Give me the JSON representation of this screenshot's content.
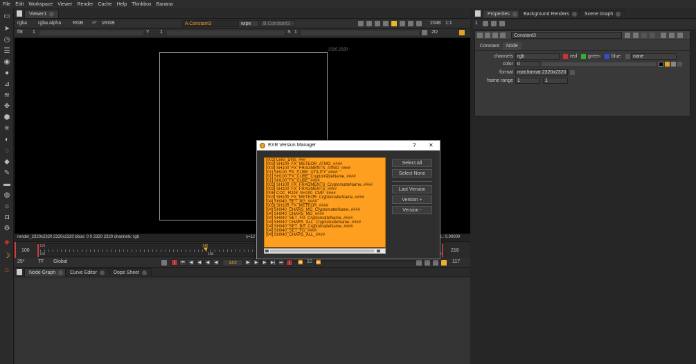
{
  "menu": [
    "File",
    "Edit",
    "Workspace",
    "Viewer",
    "Render",
    "Cache",
    "Help",
    "Thinkbox",
    "Banana"
  ],
  "viewer": {
    "tab_label": "Viewer1",
    "channels": "rgba",
    "alpha": "rgba.alpha",
    "colorspace": "RGB",
    "ip": "IP",
    "lut": "sRGB",
    "input_a": "A  Constant3",
    "wipe": "wipe",
    "input_b": "B  Constant3",
    "proxy_res": "2048",
    "zoom": "1:1",
    "fstop": "f/8",
    "frame_step": "1",
    "y_label": "Y",
    "y_value": "1",
    "s_label": "S",
    "s_value": "1",
    "view_mode": "2D",
    "format_label": "2320,2320",
    "status": "render_2320x2320 2320x2320  bbox: 0 0 2320 2320 channels: rgb",
    "status_coord": "x=12",
    "status_right": "L: 0.00000"
  },
  "timeline": {
    "in_frame": "100",
    "marker_start": "100",
    "current_frame": "142",
    "tick_150": "150",
    "out_marker": "216",
    "out_frame": "216",
    "sub_start": "100",
    "sub_end": "216",
    "fps": "25*",
    "tf": "TF",
    "range_mode": "Global",
    "play_frame": "142",
    "increment": "10",
    "end_frame": "117"
  },
  "bottom_tabs": [
    "Node Graph",
    "Curve Editor",
    "Dope Sheet"
  ],
  "properties": {
    "tabs": [
      "Properties",
      "Background Renders",
      "Scene Graph"
    ],
    "count": "1",
    "node_name": "Constant3",
    "subtabs": [
      "Constant",
      "Node"
    ],
    "channels_label": "channels",
    "channels_value": "rgb",
    "ch_red": "red",
    "ch_green": "green",
    "ch_blue": "blue",
    "ch_none": "none",
    "color_label": "color",
    "color_value": "0",
    "format_label": "format",
    "format_value": "root.format 2320x2320",
    "frame_range_label": "frame range",
    "frame_range_start": "1",
    "frame_range_end": "1"
  },
  "dialog": {
    "title": "EXR Version Manager",
    "help": "?",
    "close": "✕",
    "items": [
      "[001]   Lens_Dirts_###",
      "[003]   SH100_FX_METEOR_ATMO_####",
      "[003]   SH100_FX_FRAGMENTS_ATMO_####",
      "[01]    SH100_FX_CUBE_UTILITY_####",
      "[01]    SH100_FX_CUBE_CryptomatteName..####",
      "[01]    SH100_FX_CUBE_####",
      "[003]   SH100_FX_FRAGMENTS_CryptomatteName..####",
      "[003]   SH100_FX_FRAGMENTS_####",
      "[006]   COC_HJ25_SH100_CMP_####",
      "[003]   SH100_FX_METEOR_CryptomatteName..####",
      "[04]    SH040_SET_BG_####",
      "[003]   SH100_FX_METEOR_####",
      "[04]    SH040_CHARS_MG_CryptomatteName..####",
      "[04]    SH040_CHARS_MG_####",
      "[04]    SH040_SET_FG_CryptomatteName..####",
      "[04]    SH040_CHARS_ALL_CryptomatteName..####",
      "[04]    SH040_SET_BG_CryptomatteName..####",
      "[04]    SH040_SET_FG_####",
      "[04]    SH040_CHARS_ALL_####"
    ],
    "btn_select_all": "Select All",
    "btn_select_none": "Select None",
    "btn_last_version": "Last Version",
    "btn_version_up": "Version +",
    "btn_version_down": "Version -"
  },
  "colors": {
    "accent_orange": "#ff9f1f",
    "viewport": "#000000",
    "panel": "#262626"
  }
}
